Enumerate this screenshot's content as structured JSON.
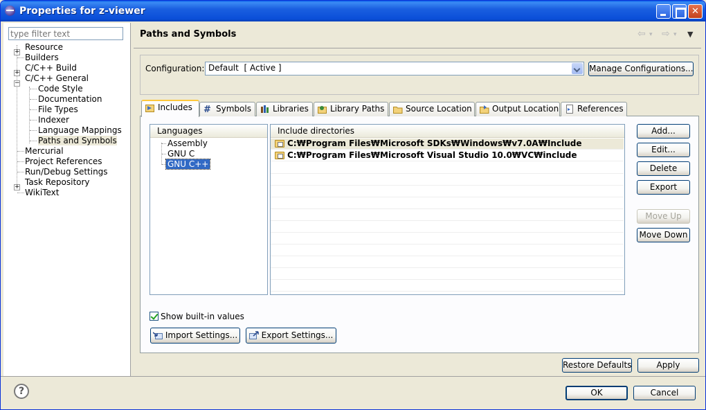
{
  "window": {
    "title": "Properties for z-viewer"
  },
  "filter": {
    "placeholder": "type filter text"
  },
  "tree": {
    "resource": "Resource",
    "builders": "Builders",
    "cpp_build": "C/C++ Build",
    "cpp_general": "C/C++ General",
    "code_style": "Code Style",
    "documentation": "Documentation",
    "file_types": "File Types",
    "indexer": "Indexer",
    "language_mappings": "Language Mappings",
    "paths_symbols": "Paths and Symbols",
    "mercurial": "Mercurial",
    "project_references": "Project References",
    "run_debug": "Run/Debug Settings",
    "task_repository": "Task Repository",
    "wikitext": "WikiText"
  },
  "page": {
    "title": "Paths and Symbols"
  },
  "configuration": {
    "label": "Configuration:",
    "value": "Default  [ Active ]",
    "manage_label": "Manage Configurations..."
  },
  "tabs": {
    "includes": "Includes",
    "symbols": "Symbols",
    "libraries": "Libraries",
    "library_paths": "Library Paths",
    "source_location": "Source Location",
    "output_location": "Output Location",
    "references": "References"
  },
  "languages": {
    "header": "Languages",
    "assembly": "Assembly",
    "gnu_c": "GNU C",
    "gnu_cpp": "GNU C++"
  },
  "includes": {
    "header": "Include directories",
    "row1": "C:₩Program Files₩Microsoft SDKs₩Windows₩v7.0A₩Include",
    "row2": "C:₩Program Files₩Microsoft Visual Studio 10.0₩VC₩include"
  },
  "side_buttons": {
    "add": "Add...",
    "edit": "Edit...",
    "delete": "Delete",
    "export": "Export",
    "move_up": "Move Up",
    "move_down": "Move Down"
  },
  "show_builtin": {
    "label": "Show built-in values",
    "checked": true
  },
  "settings_buttons": {
    "import": "Import Settings...",
    "export": "Export Settings..."
  },
  "footer": {
    "restore_defaults": "Restore Defaults",
    "apply": "Apply",
    "ok": "OK",
    "cancel": "Cancel"
  },
  "colors": {
    "titlebar": "#0a4ed8",
    "selection": "#316ac5",
    "tab_highlight": "#ffc83c"
  }
}
